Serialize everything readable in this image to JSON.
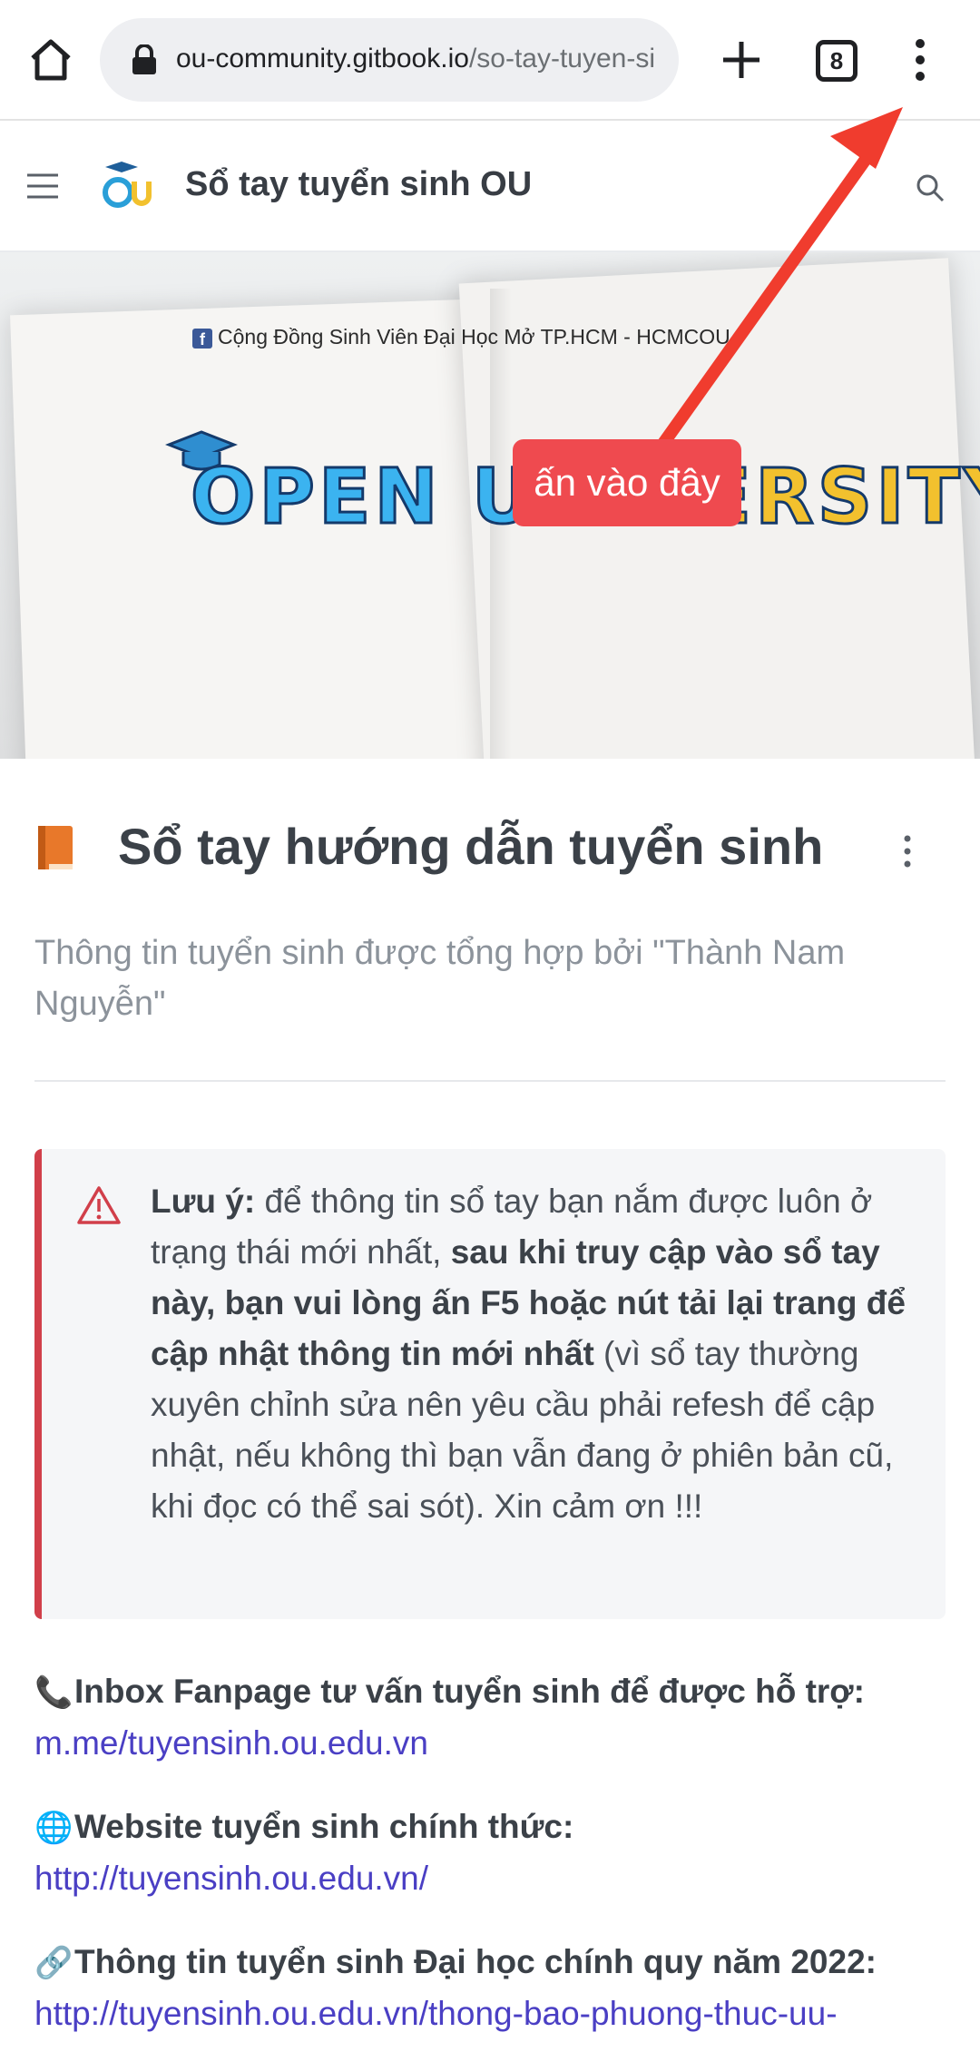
{
  "browser": {
    "url_host": "ou-community.gitbook.io",
    "url_path": "/so-tay-tuyen-si",
    "tab_count": "8"
  },
  "header": {
    "title": "Sổ tay tuyển sinh OU"
  },
  "cover": {
    "caption": "Cộng Đồng Sinh Viên Đại Học Mở TP.HCM - HCMCOU",
    "logo_word_a": "OPEN UNI",
    "logo_word_b": "VERSITY"
  },
  "annotation": {
    "label": "ấn vào đây",
    "color": "#ef4a4f"
  },
  "page": {
    "title": "Sổ tay hướng dẫn tuyển sinh",
    "description": "Thông tin tuyển sinh được tổng hợp bởi \"Thành Nam Nguyễn\""
  },
  "warning": {
    "lead": "Lưu ý:",
    "text1": " để thông tin sổ tay bạn nắm được luôn ở trạng thái mới nhất, ",
    "bold": "sau khi truy cập vào sổ tay này, bạn vui lòng ấn F5 hoặc nút tải lại trang để cập nhật thông tin mới nhất",
    "text2": " (vì sổ tay thường xuyên chỉnh sửa nên yêu cầu phải refesh để cập nhật, nếu không thì bạn vẫn đang ở phiên bản cũ, khi đọc có thể sai sót). Xin cảm ơn !!!",
    "accent_color": "#d13f4a"
  },
  "links": [
    {
      "icon": "📞",
      "label": "Inbox Fanpage tư vấn tuyển sinh để được hỗ trợ:",
      "url": "m.me/tuyensinh.ou.edu.vn"
    },
    {
      "icon": "🌐",
      "label": "Website tuyển sinh chính thức:",
      "url": "http://tuyensinh.ou.edu.vn/"
    },
    {
      "icon": "🔗",
      "label": "Thông tin tuyển sinh Đại học chính quy năm 2022:",
      "url": "http://tuyensinh.ou.edu.vn/thong-bao-phuong-thuc-uu-"
    }
  ]
}
